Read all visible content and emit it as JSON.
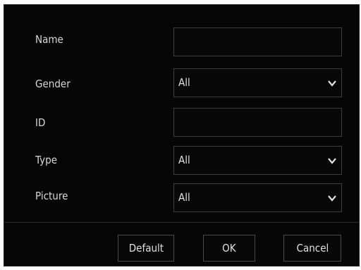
{
  "form": {
    "fields": {
      "name": {
        "label": "Name",
        "value": ""
      },
      "gender": {
        "label": "Gender",
        "value": "All"
      },
      "id": {
        "label": "ID",
        "value": ""
      },
      "type": {
        "label": "Type",
        "value": "All"
      },
      "picture": {
        "label": "Picture",
        "value": "All"
      }
    }
  },
  "buttons": {
    "default_label": "Default",
    "ok_label": "OK",
    "cancel_label": "Cancel"
  },
  "icons": {
    "dropdown": "chevron-down-icon"
  },
  "colors": {
    "background": "#060606",
    "border": "#3d3d3d",
    "text": "#d8d8d8"
  }
}
